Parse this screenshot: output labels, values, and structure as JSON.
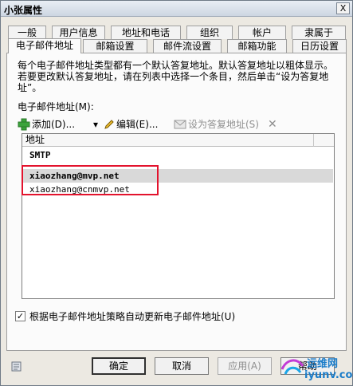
{
  "window": {
    "title": "小张属性",
    "close_label": "X"
  },
  "tabs_row1": [
    "一般",
    "用户信息",
    "地址和电话",
    "组织",
    "帐户",
    "隶属于"
  ],
  "tabs_row2": [
    "电子邮件地址",
    "邮箱设置",
    "邮件流设置",
    "邮箱功能",
    "日历设置"
  ],
  "description": "每个电子邮件地址类型都有一个默认答复地址。默认答复地址以粗体显示。若要更改默认答复地址，请在列表中选择一个条目，然后单击“设为答复地址”。",
  "email_list_label": "电子邮件地址(M):",
  "toolbar": {
    "add": "添加(D)...",
    "edit": "编辑(E)...",
    "set_reply": "设为答复地址(S)",
    "remove_icon": "remove-icon"
  },
  "list": {
    "header": "地址",
    "group": "SMTP",
    "addresses": [
      "xiaozhang@mvp.net",
      "xiaozhang@cnmvp.net"
    ]
  },
  "checkbox": {
    "label": "根据电子邮件地址策略自动更新电子邮件地址(U)",
    "checked": true,
    "mark": "✓"
  },
  "buttons": {
    "ok": "确定",
    "cancel": "取消",
    "apply": "应用(A)",
    "help": "帮助"
  },
  "watermark": {
    "text1": "运维网",
    "text2": "iyunv.com"
  },
  "colors": {
    "highlight": "#e3132d",
    "selected_row": "#d9d9d9"
  }
}
